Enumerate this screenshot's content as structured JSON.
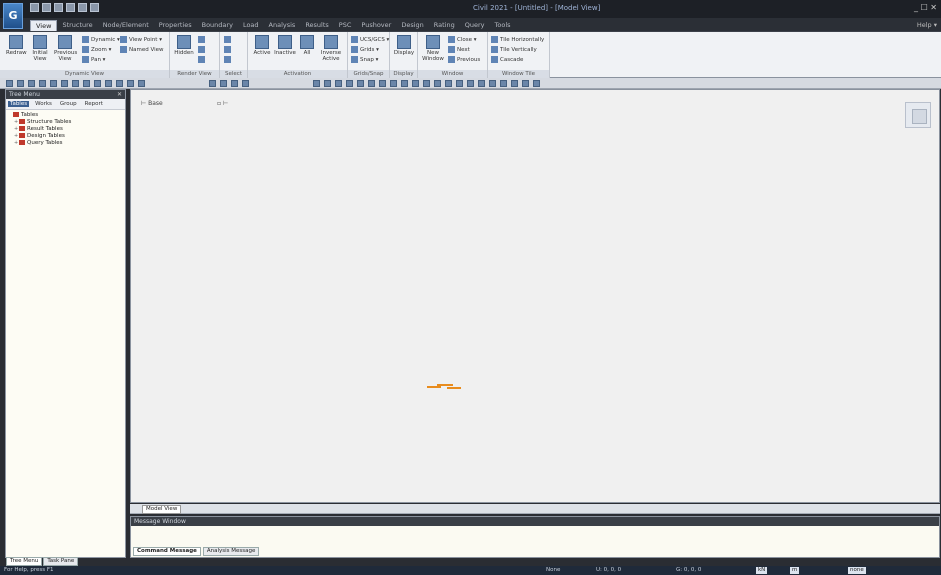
{
  "window": {
    "app_logo": "G",
    "title": "Civil 2021 - [Untitled] - [Model View]",
    "controls": "_ ☐ ✕"
  },
  "menu": {
    "tabs": [
      "View",
      "Structure",
      "Node/Element",
      "Properties",
      "Boundary",
      "Load",
      "Analysis",
      "Results",
      "PSC",
      "Pushover",
      "Design",
      "Rating",
      "Query",
      "Tools"
    ],
    "active": "View",
    "help": "Help ▾"
  },
  "ribbon": {
    "groups": [
      {
        "label": "Dynamic View"
      },
      {
        "label": "Render View"
      },
      {
        "label": "Select"
      },
      {
        "label": "Activation"
      },
      {
        "label": "Grids/Snap"
      },
      {
        "label": "Display"
      },
      {
        "label": "Window"
      },
      {
        "label": "Window Tile"
      }
    ],
    "buttons": {
      "redraw": "Redraw",
      "initial_view": "Initial View",
      "previous_view": "Previous View",
      "dynamic": "Dynamic ▾",
      "zoom": "Zoom ▾",
      "pan": "Pan ▾",
      "view_point": "View Point ▾",
      "named_view": "Named View",
      "hidden": "Hidden",
      "active": "Active",
      "inactive": "Inactive",
      "all": "All",
      "inverse_active": "Inverse Active",
      "ucs_gcs": "UCS/GCS ▾",
      "grids": "Grids ▾",
      "snap": "Snap ▾",
      "display": "Display",
      "new_window": "New Window",
      "close": "Close ▾",
      "next": "Next",
      "previous": "Previous",
      "tile_horizontally": "Tile Horizontally",
      "tile_vertically": "Tile Vertically",
      "cascade": "Cascade"
    }
  },
  "tree_menu": {
    "title": "Tree Menu",
    "tabs": [
      "Tables",
      "Works",
      "Group",
      "Report"
    ],
    "active_tab": "Tables",
    "items": [
      "Tables",
      "Structure Tables",
      "Result Tables",
      "Design Tables",
      "Query Tables"
    ],
    "bottom_tabs": [
      "Tree Menu",
      "Task Pane"
    ]
  },
  "model_view": {
    "label_left": "Base",
    "label_right": "",
    "tab": "Model View"
  },
  "message_window": {
    "title": "Message Window",
    "tabs": [
      "Command Message",
      "Analysis Message"
    ]
  },
  "statusbar": {
    "help_text": "For Help, press F1",
    "node": "None",
    "u": "U: 0, 0, 0",
    "g": "G: 0, 0, 0",
    "unit1": "kN",
    "unit2": "m",
    "mode": "none"
  }
}
